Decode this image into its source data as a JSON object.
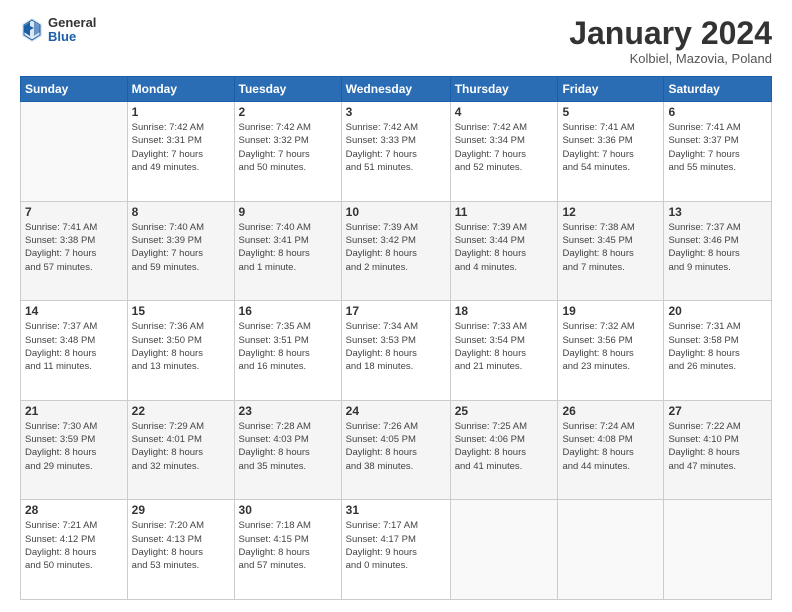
{
  "logo": {
    "general": "General",
    "blue": "Blue"
  },
  "header": {
    "title": "January 2024",
    "subtitle": "Kolbiel, Mazovia, Poland"
  },
  "days_of_week": [
    "Sunday",
    "Monday",
    "Tuesday",
    "Wednesday",
    "Thursday",
    "Friday",
    "Saturday"
  ],
  "weeks": [
    [
      {
        "day": "",
        "info": ""
      },
      {
        "day": "1",
        "info": "Sunrise: 7:42 AM\nSunset: 3:31 PM\nDaylight: 7 hours\nand 49 minutes."
      },
      {
        "day": "2",
        "info": "Sunrise: 7:42 AM\nSunset: 3:32 PM\nDaylight: 7 hours\nand 50 minutes."
      },
      {
        "day": "3",
        "info": "Sunrise: 7:42 AM\nSunset: 3:33 PM\nDaylight: 7 hours\nand 51 minutes."
      },
      {
        "day": "4",
        "info": "Sunrise: 7:42 AM\nSunset: 3:34 PM\nDaylight: 7 hours\nand 52 minutes."
      },
      {
        "day": "5",
        "info": "Sunrise: 7:41 AM\nSunset: 3:36 PM\nDaylight: 7 hours\nand 54 minutes."
      },
      {
        "day": "6",
        "info": "Sunrise: 7:41 AM\nSunset: 3:37 PM\nDaylight: 7 hours\nand 55 minutes."
      }
    ],
    [
      {
        "day": "7",
        "info": "Sunrise: 7:41 AM\nSunset: 3:38 PM\nDaylight: 7 hours\nand 57 minutes."
      },
      {
        "day": "8",
        "info": "Sunrise: 7:40 AM\nSunset: 3:39 PM\nDaylight: 7 hours\nand 59 minutes."
      },
      {
        "day": "9",
        "info": "Sunrise: 7:40 AM\nSunset: 3:41 PM\nDaylight: 8 hours\nand 1 minute."
      },
      {
        "day": "10",
        "info": "Sunrise: 7:39 AM\nSunset: 3:42 PM\nDaylight: 8 hours\nand 2 minutes."
      },
      {
        "day": "11",
        "info": "Sunrise: 7:39 AM\nSunset: 3:44 PM\nDaylight: 8 hours\nand 4 minutes."
      },
      {
        "day": "12",
        "info": "Sunrise: 7:38 AM\nSunset: 3:45 PM\nDaylight: 8 hours\nand 7 minutes."
      },
      {
        "day": "13",
        "info": "Sunrise: 7:37 AM\nSunset: 3:46 PM\nDaylight: 8 hours\nand 9 minutes."
      }
    ],
    [
      {
        "day": "14",
        "info": "Sunrise: 7:37 AM\nSunset: 3:48 PM\nDaylight: 8 hours\nand 11 minutes."
      },
      {
        "day": "15",
        "info": "Sunrise: 7:36 AM\nSunset: 3:50 PM\nDaylight: 8 hours\nand 13 minutes."
      },
      {
        "day": "16",
        "info": "Sunrise: 7:35 AM\nSunset: 3:51 PM\nDaylight: 8 hours\nand 16 minutes."
      },
      {
        "day": "17",
        "info": "Sunrise: 7:34 AM\nSunset: 3:53 PM\nDaylight: 8 hours\nand 18 minutes."
      },
      {
        "day": "18",
        "info": "Sunrise: 7:33 AM\nSunset: 3:54 PM\nDaylight: 8 hours\nand 21 minutes."
      },
      {
        "day": "19",
        "info": "Sunrise: 7:32 AM\nSunset: 3:56 PM\nDaylight: 8 hours\nand 23 minutes."
      },
      {
        "day": "20",
        "info": "Sunrise: 7:31 AM\nSunset: 3:58 PM\nDaylight: 8 hours\nand 26 minutes."
      }
    ],
    [
      {
        "day": "21",
        "info": "Sunrise: 7:30 AM\nSunset: 3:59 PM\nDaylight: 8 hours\nand 29 minutes."
      },
      {
        "day": "22",
        "info": "Sunrise: 7:29 AM\nSunset: 4:01 PM\nDaylight: 8 hours\nand 32 minutes."
      },
      {
        "day": "23",
        "info": "Sunrise: 7:28 AM\nSunset: 4:03 PM\nDaylight: 8 hours\nand 35 minutes."
      },
      {
        "day": "24",
        "info": "Sunrise: 7:26 AM\nSunset: 4:05 PM\nDaylight: 8 hours\nand 38 minutes."
      },
      {
        "day": "25",
        "info": "Sunrise: 7:25 AM\nSunset: 4:06 PM\nDaylight: 8 hours\nand 41 minutes."
      },
      {
        "day": "26",
        "info": "Sunrise: 7:24 AM\nSunset: 4:08 PM\nDaylight: 8 hours\nand 44 minutes."
      },
      {
        "day": "27",
        "info": "Sunrise: 7:22 AM\nSunset: 4:10 PM\nDaylight: 8 hours\nand 47 minutes."
      }
    ],
    [
      {
        "day": "28",
        "info": "Sunrise: 7:21 AM\nSunset: 4:12 PM\nDaylight: 8 hours\nand 50 minutes."
      },
      {
        "day": "29",
        "info": "Sunrise: 7:20 AM\nSunset: 4:13 PM\nDaylight: 8 hours\nand 53 minutes."
      },
      {
        "day": "30",
        "info": "Sunrise: 7:18 AM\nSunset: 4:15 PM\nDaylight: 8 hours\nand 57 minutes."
      },
      {
        "day": "31",
        "info": "Sunrise: 7:17 AM\nSunset: 4:17 PM\nDaylight: 9 hours\nand 0 minutes."
      },
      {
        "day": "",
        "info": ""
      },
      {
        "day": "",
        "info": ""
      },
      {
        "day": "",
        "info": ""
      }
    ]
  ]
}
